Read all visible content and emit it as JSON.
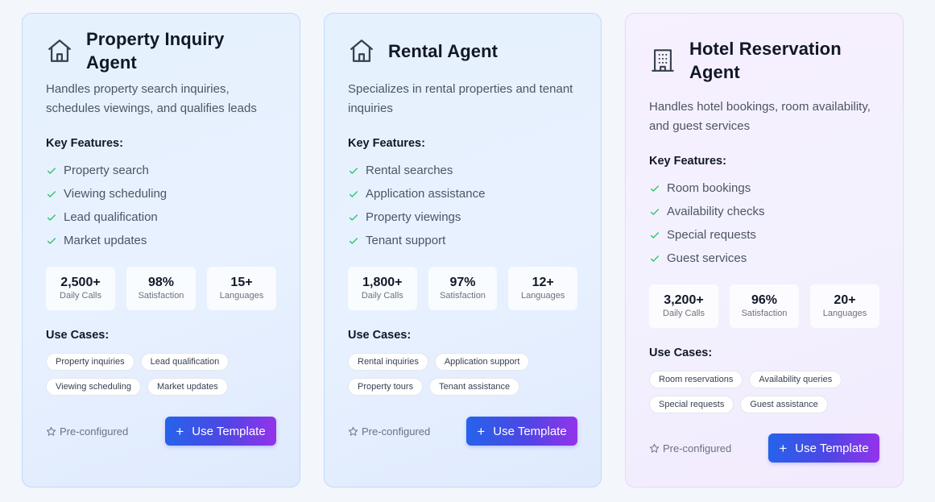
{
  "cards": [
    {
      "title": "Property Inquiry Agent",
      "icon": "house-icon",
      "description": "Handles property search inquiries, schedules viewings, and qualifies leads",
      "features_heading": "Key Features:",
      "features": [
        "Property search",
        "Viewing scheduling",
        "Lead qualification",
        "Market updates"
      ],
      "stats": [
        {
          "value": "2,500+",
          "label": "Daily Calls"
        },
        {
          "value": "98%",
          "label": "Satisfaction"
        },
        {
          "value": "15+",
          "label": "Languages"
        }
      ],
      "use_cases_heading": "Use Cases:",
      "use_cases": [
        "Property inquiries",
        "Lead qualification",
        "Viewing scheduling",
        "Market updates"
      ],
      "preconfigured": "Pre-configured",
      "button": "Use Template"
    },
    {
      "title": "Rental Agent",
      "icon": "house-icon",
      "description": "Specializes in rental properties and tenant inquiries",
      "features_heading": "Key Features:",
      "features": [
        "Rental searches",
        "Application assistance",
        "Property viewings",
        "Tenant support"
      ],
      "stats": [
        {
          "value": "1,800+",
          "label": "Daily Calls"
        },
        {
          "value": "97%",
          "label": "Satisfaction"
        },
        {
          "value": "12+",
          "label": "Languages"
        }
      ],
      "use_cases_heading": "Use Cases:",
      "use_cases": [
        "Rental inquiries",
        "Application support",
        "Property tours",
        "Tenant assistance"
      ],
      "preconfigured": "Pre-configured",
      "button": "Use Template"
    },
    {
      "title": "Hotel Reservation Agent",
      "icon": "building-icon",
      "description": "Handles hotel bookings, room availability, and guest services",
      "features_heading": "Key Features:",
      "features": [
        "Room bookings",
        "Availability checks",
        "Special requests",
        "Guest services"
      ],
      "stats": [
        {
          "value": "3,200+",
          "label": "Daily Calls"
        },
        {
          "value": "96%",
          "label": "Satisfaction"
        },
        {
          "value": "20+",
          "label": "Languages"
        }
      ],
      "use_cases_heading": "Use Cases:",
      "use_cases": [
        "Room reservations",
        "Availability queries",
        "Special requests",
        "Guest assistance"
      ],
      "preconfigured": "Pre-configured",
      "button": "Use Template"
    }
  ],
  "colors": {
    "check": "#22c55e",
    "button_gradient_start": "#2563eb",
    "button_gradient_end": "#9333ea"
  }
}
